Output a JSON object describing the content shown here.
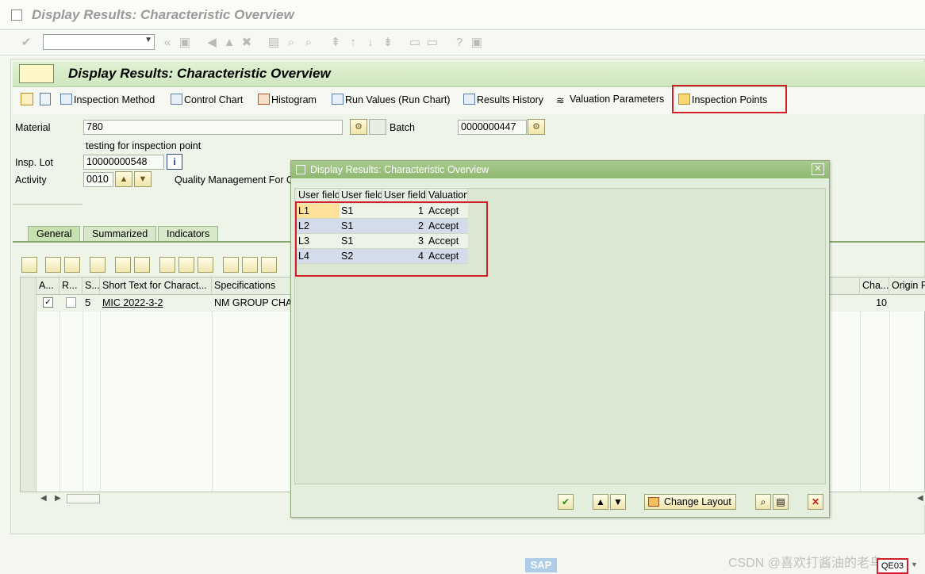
{
  "window": {
    "title": "Display Results: Characteristic Overview"
  },
  "header": {
    "title": "Display Results: Characteristic Overview"
  },
  "toolbar": {
    "items": [
      {
        "label": "Inspection Method",
        "icon": "inspection-method-icon"
      },
      {
        "label": "Control Chart",
        "icon": "control-chart-icon"
      },
      {
        "label": "Histogram",
        "icon": "histogram-icon"
      },
      {
        "label": "Run Values (Run Chart)",
        "icon": "run-chart-icon"
      },
      {
        "label": "Results History",
        "icon": "results-history-icon"
      },
      {
        "label": "Valuation Parameters",
        "icon": "valuation-icon"
      },
      {
        "label": "Inspection Points",
        "icon": "inspection-points-icon"
      }
    ]
  },
  "fields": {
    "material_label": "Material",
    "material_value": "780",
    "material_desc": "testing for inspection point",
    "batch_label": "Batch",
    "batch_value": "0000000447",
    "insp_lot_label": "Insp. Lot",
    "insp_lot_value": "10000000548",
    "activity_label": "Activity",
    "activity_value": "0010",
    "activity_desc": "Quality Management For Q"
  },
  "tabs": [
    "General",
    "Summarized",
    "Indicators"
  ],
  "grid": {
    "columns": [
      "A...",
      "R...",
      "S...",
      "Short Text for Charact...",
      "Specifications",
      "Cha...",
      "Origin R"
    ],
    "rows": [
      {
        "a_checked": "✓",
        "status": "5",
        "short_text": "MIC 2022-3-2",
        "spec": "NM GROUP CHARA",
        "cha": "10"
      }
    ]
  },
  "popup": {
    "title": "Display Results: Characteristic Overview",
    "columns": [
      "User field",
      "User field",
      "User field",
      "Valuation"
    ],
    "rows": [
      [
        "L1",
        "S1",
        "1",
        "Accept"
      ],
      [
        "L2",
        "S1",
        "2",
        "Accept"
      ],
      [
        "L3",
        "S1",
        "3",
        "Accept"
      ],
      [
        "L4",
        "S2",
        "4",
        "Accept"
      ]
    ],
    "footer": {
      "change_layout": "Change Layout"
    }
  },
  "status": {
    "tcode": "QE03",
    "watermark": "CSDN @喜欢打酱油的老鸟",
    "sap_logo": "SAP"
  },
  "colors": {
    "highlight_red": "#d0212b",
    "header_green": "#cfe6bf",
    "popup_title": "#8fb872"
  }
}
